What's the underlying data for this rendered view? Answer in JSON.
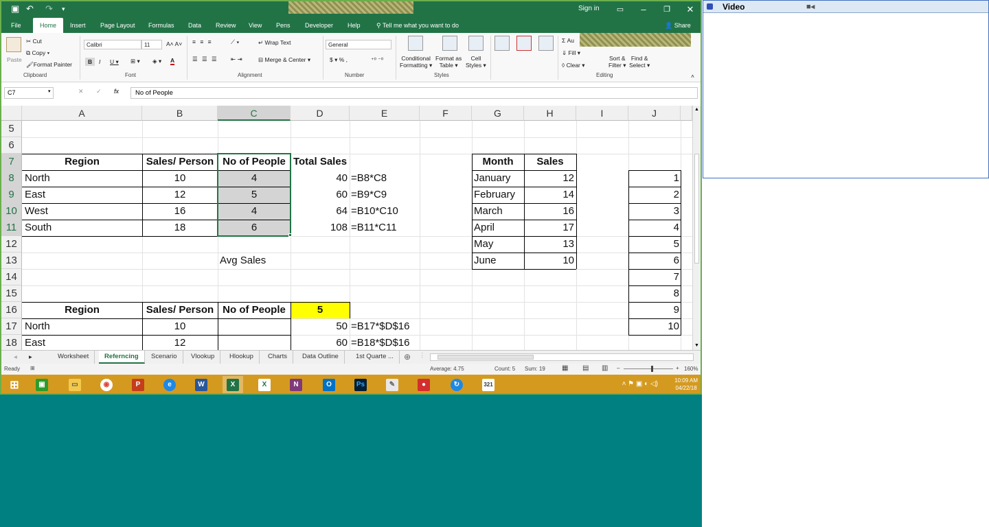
{
  "titlebar": {
    "signin": "Sign in"
  },
  "ribbon_tabs": [
    "File",
    "Home",
    "Insert",
    "Page Layout",
    "Formulas",
    "Data",
    "Review",
    "View",
    "Pens",
    "Developer",
    "Help"
  ],
  "tell_me": "Tell me what you want to do",
  "share": "Share",
  "clipboard": {
    "paste": "Paste",
    "cut": "Cut",
    "copy": "Copy",
    "format_painter": "Format Painter",
    "group": "Clipboard"
  },
  "font": {
    "name": "Calibri",
    "size": "11",
    "group": "Font"
  },
  "alignment": {
    "wrap": "Wrap Text",
    "merge": "Merge & Center",
    "group": "Alignment"
  },
  "number": {
    "format": "General",
    "group": "Number"
  },
  "styles": {
    "conditional1": "Conditional",
    "conditional2": "Formatting",
    "format_table1": "Format as",
    "format_table2": "Table",
    "cell_styles1": "Cell",
    "cell_styles2": "Styles",
    "group": "Styles"
  },
  "cells": {
    "A7": "Region",
    "B7": "Sales/ Person",
    "C7": "No of People",
    "D7": "Total Sales",
    "A8": "North",
    "B8": "10",
    "C8": "4",
    "D8": "40",
    "E8": "=B8*C8",
    "A9": "East",
    "B9": "12",
    "C9": "5",
    "D9": "60",
    "E9": "=B9*C9",
    "A10": "West",
    "B10": "16",
    "C10": "4",
    "D10": "64",
    "E10": "=B10*C10",
    "A11": "South",
    "B11": "18",
    "C11": "6",
    "D11": "108",
    "E11": "=B11*C11",
    "C13": "Avg Sales",
    "A16": "Region",
    "B16": "Sales/ Person",
    "C16": "No of People",
    "D16": "5",
    "A17": "North",
    "B17": "10",
    "D17": "50",
    "E17": "=B17*$D$16",
    "A18": "East",
    "B18": "12",
    "D18": "60",
    "E18": "=B18*$D$16",
    "G7": "Month",
    "H7": "Sales",
    "G8": "January",
    "H8": "12",
    "G9": "February",
    "H9": "14",
    "G10": "March",
    "H10": "16",
    "G11": "April",
    "H11": "17",
    "G12": "May",
    "H12": "13",
    "G13": "June",
    "H13": "10",
    "J8": "1",
    "J9": "2",
    "J10": "3",
    "J11": "4",
    "J12": "5",
    "J13": "6",
    "J14": "7",
    "J15": "8",
    "J16": "9",
    "J17": "10"
  },
  "editing": {
    "autosum": "Au",
    "fill": "Fill",
    "clear": "Clear",
    "sort1": "Sort &",
    "sort2": "Filter",
    "find1": "Find &",
    "find2": "Select",
    "group": "Editing"
  },
  "formula_bar": {
    "name_box": "C7",
    "fx": "fx",
    "content": "No of People"
  },
  "columns": [
    "A",
    "B",
    "C",
    "D",
    "E",
    "F",
    "G",
    "H",
    "I",
    "J"
  ],
  "rows": [
    "5",
    "6",
    "7",
    "8",
    "9",
    "10",
    "11",
    "12",
    "13",
    "14",
    "15",
    "16",
    "17",
    "18"
  ],
  "sheet_tabs": [
    "Worksheet",
    "Referncing",
    "Scenario",
    "Vlookup",
    "Hlookup",
    "Charts",
    "Data Outline",
    "1st Quarte ..."
  ],
  "active_sheet": "Referncing",
  "status": {
    "ready": "Ready",
    "average": "Average: 4.75",
    "count": "Count: 5",
    "sum": "Sum: 19",
    "zoom": "160%"
  },
  "clock": {
    "time": "10:09 AM",
    "date": "04/22/18"
  },
  "video": {
    "title": "Video"
  },
  "colors": {
    "excel_green": "#217346",
    "selection_fill": "#d4d4d4",
    "highlight_yellow": "#ffff00",
    "taskbar": "#d49a20",
    "desktop": "#008080"
  }
}
